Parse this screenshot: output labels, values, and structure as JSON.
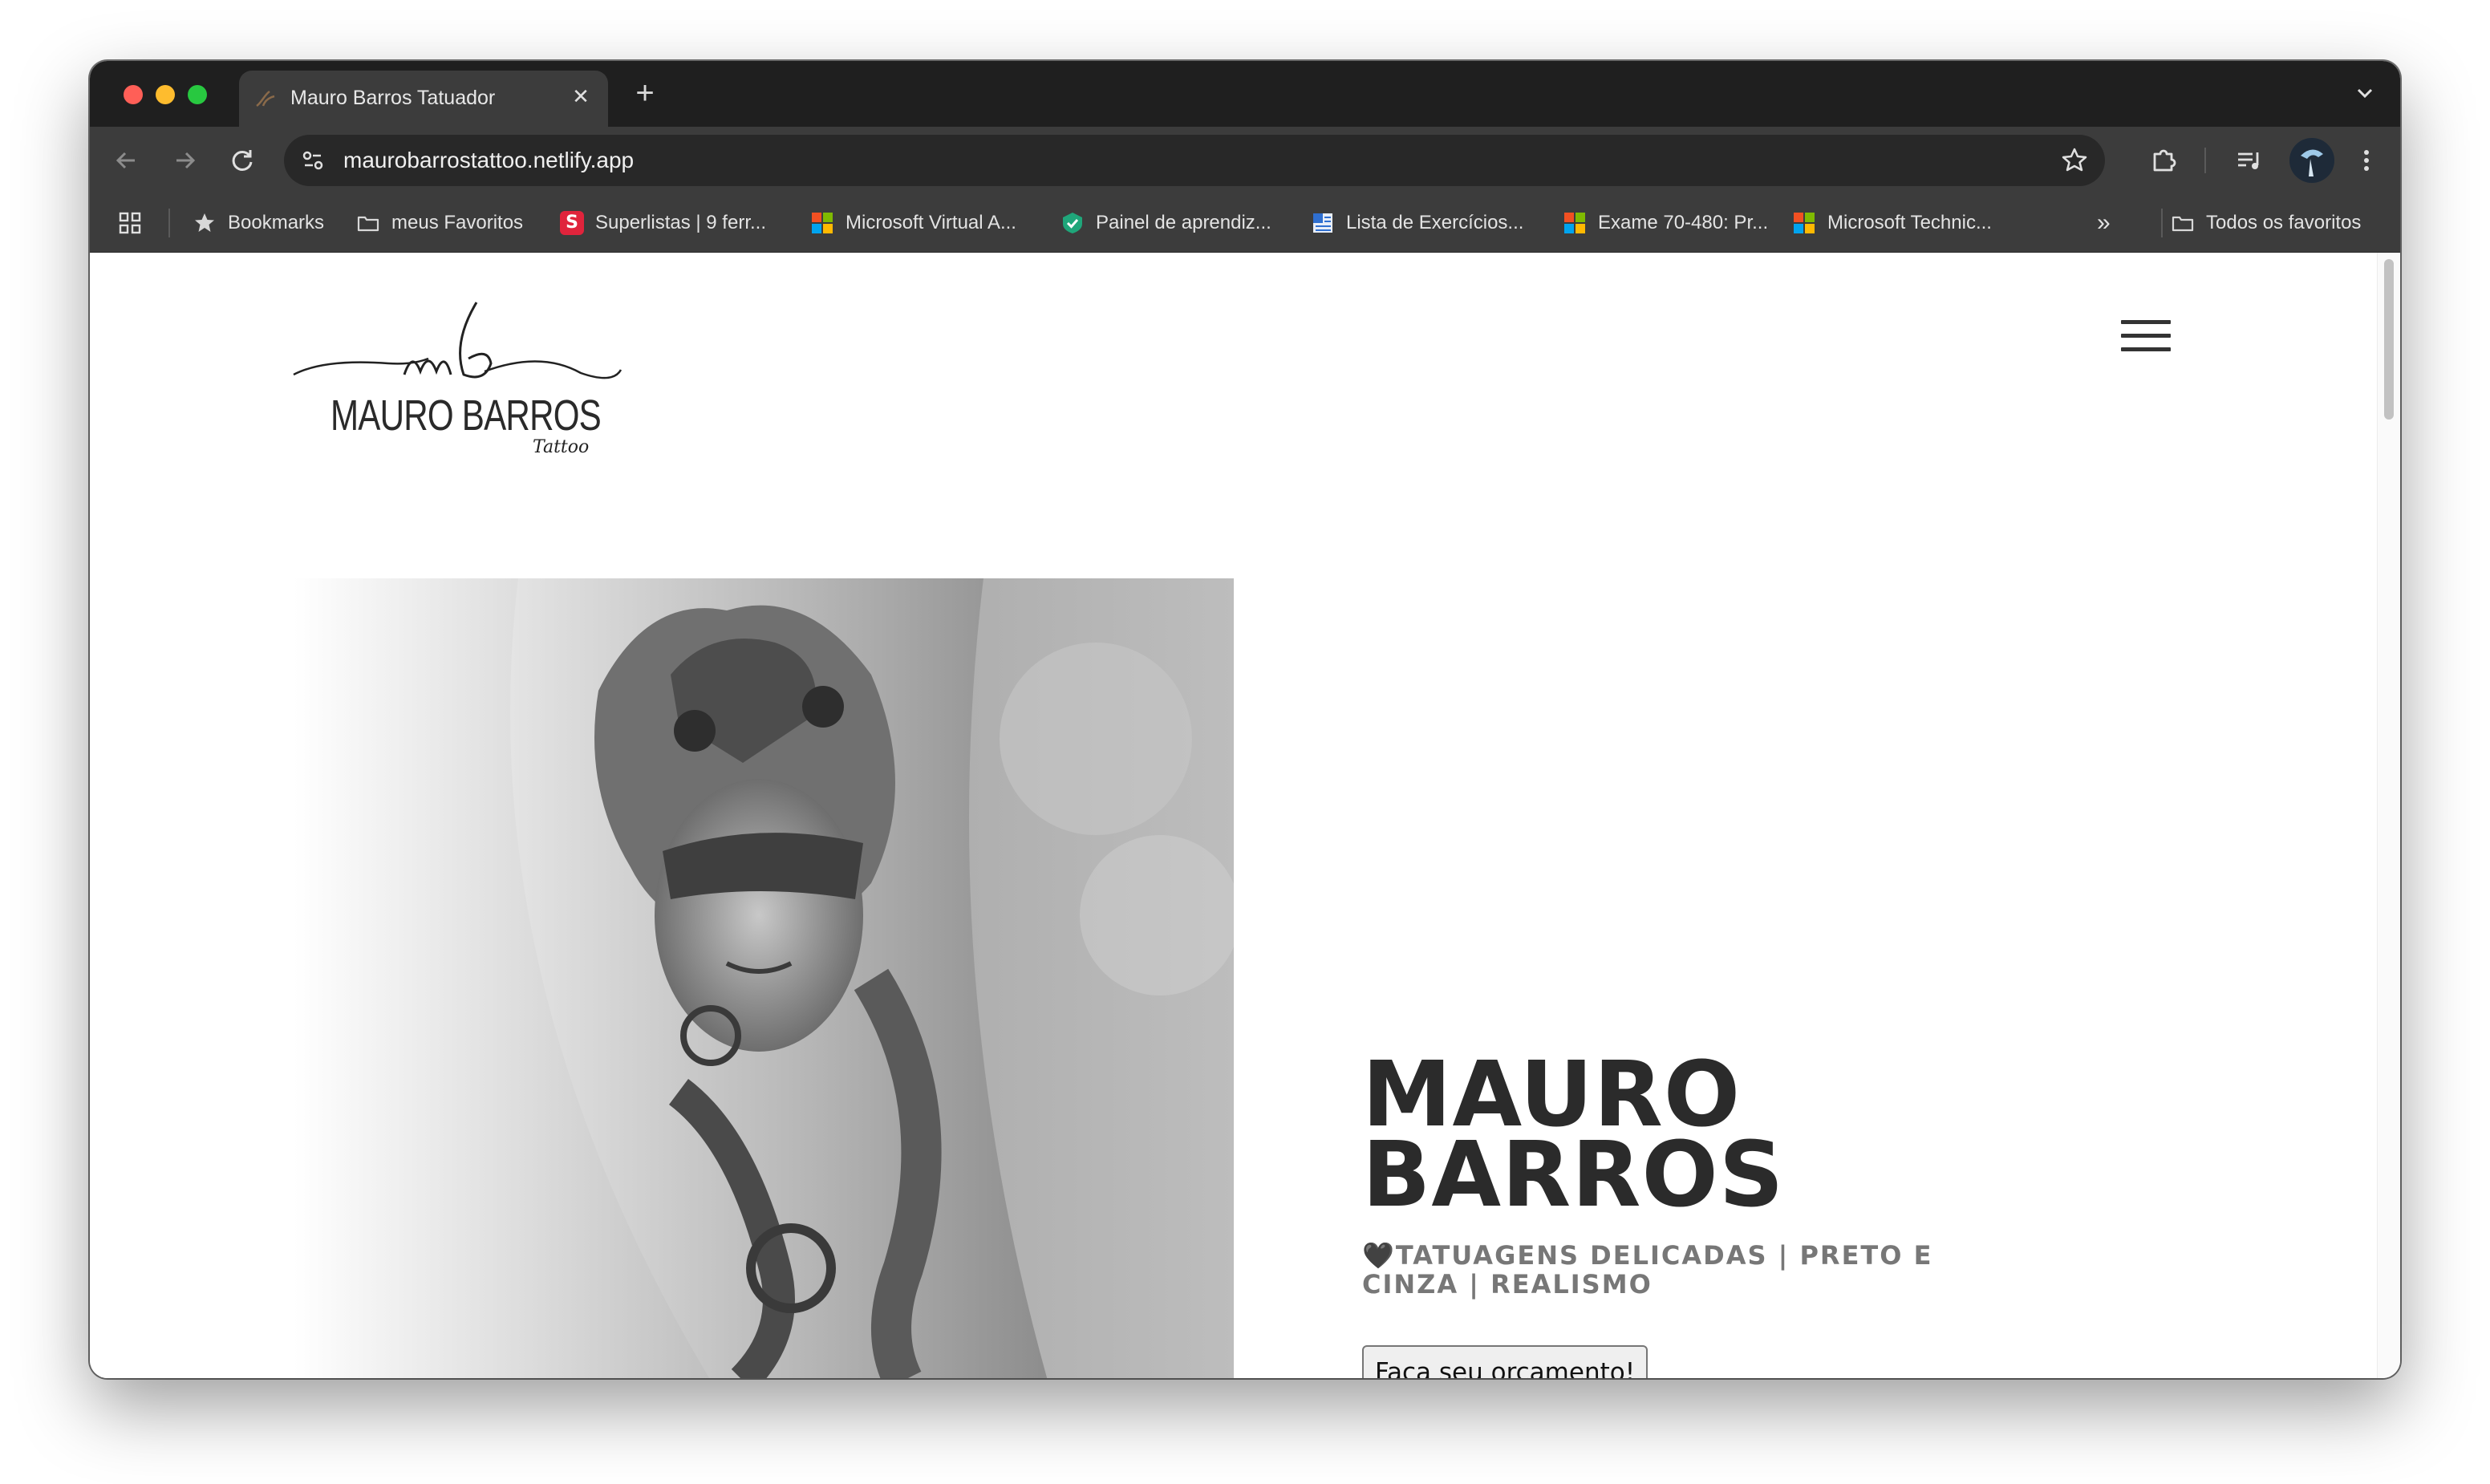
{
  "browser": {
    "tab": {
      "title": "Mauro Barros Tatuador",
      "close_glyph": "✕"
    },
    "new_tab_glyph": "+",
    "address_bar": {
      "url": "maurobarrostattoo.netlify.app"
    },
    "bookmarks": [
      {
        "label": "Bookmarks",
        "icon": "star-icon"
      },
      {
        "label": "meus Favoritos",
        "icon": "folder-icon"
      },
      {
        "label": "Superlistas | 9 ferr...",
        "icon": "superlistas-icon"
      },
      {
        "label": "Microsoft Virtual A...",
        "icon": "microsoft-icon"
      },
      {
        "label": "Painel de aprendiz...",
        "icon": "shield-check-icon"
      },
      {
        "label": "Lista de Exercícios...",
        "icon": "document-icon"
      },
      {
        "label": "Exame 70-480: Pr...",
        "icon": "microsoft-icon"
      },
      {
        "label": "Microsoft Technic...",
        "icon": "microsoft-icon"
      }
    ],
    "bookmarks_overflow": "»",
    "all_bookmarks": {
      "label": "Todos os favoritos",
      "icon": "folder-icon"
    }
  },
  "site": {
    "logo": {
      "monogram": "mb",
      "name": "MAURO BARROS",
      "sub": "Tattoo"
    },
    "hero": {
      "title_line1": "MAURO",
      "title_line2": "BARROS",
      "subtitle": "🖤TATUAGENS DELICADAS | PRETO E CINZA | REALISMO",
      "cta_label": "Faça seu orçamento!"
    }
  },
  "colors": {
    "tabstrip": "#1f1f1f",
    "toolbar": "#3c3c3c",
    "title_text": "#2b2b2b",
    "subtitle_text": "#777777"
  }
}
